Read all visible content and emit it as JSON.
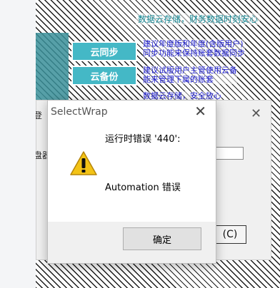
{
  "background_app": {
    "banner_text": "数据云存储，财务数据时刻安心",
    "cloud_sync_label": "云同步",
    "cloud_sync_desc_1": "建议年度版和年度(含版用户)",
    "cloud_sync_desc_2": "同步功能来保持账套数据同步",
    "cloud_audit_label": "云备份",
    "cloud_audit_desc_1": "建议试版用户主管使用云备",
    "cloud_audit_desc_2": "能来管理下属的账套",
    "row3_desc": "数据云存储，安全放心",
    "partial_left_label_1": "登",
    "partial_left_label_2": "盘器",
    "c_button_label": "(C)"
  },
  "dialog": {
    "title": "SelectWrap",
    "message_line1": "运行时错误 '440':",
    "message_line2": "Automation 错误",
    "ok_label": "确定",
    "close_symbol": "✕",
    "icon": "warning-icon"
  },
  "colors": {
    "accent_teal": "#44b8c6",
    "text_blue": "#1b1bd0",
    "warning_yellow": "#f3c316"
  }
}
